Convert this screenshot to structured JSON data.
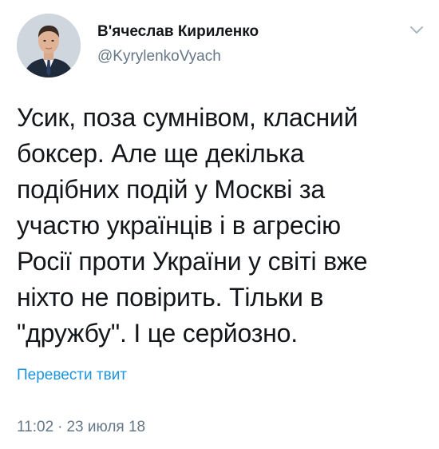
{
  "author": {
    "display_name": "В'ячеслав Кириленко",
    "handle": "@KyrylenkoVyach"
  },
  "tweet": {
    "text": "Усик, поза сумнівом, класний\nбоксер. Але ще декілька\nподібних подій у Москві за\nучастю українців і в агресію\nРосії проти України у світі вже\nніхто не повірить. Тільки в\n\"дружбу\". І це серйозно.",
    "translate_label": "Перевести твит",
    "time": "11:02",
    "separator": "·",
    "date": "23 июля 18"
  },
  "icons": {
    "menu_caret": "chevron-down-icon",
    "avatar": "avatar"
  },
  "colors": {
    "link": "#1b95e0",
    "secondary_text": "#657786",
    "primary_text": "#14171a",
    "caret": "#aab8c2"
  }
}
